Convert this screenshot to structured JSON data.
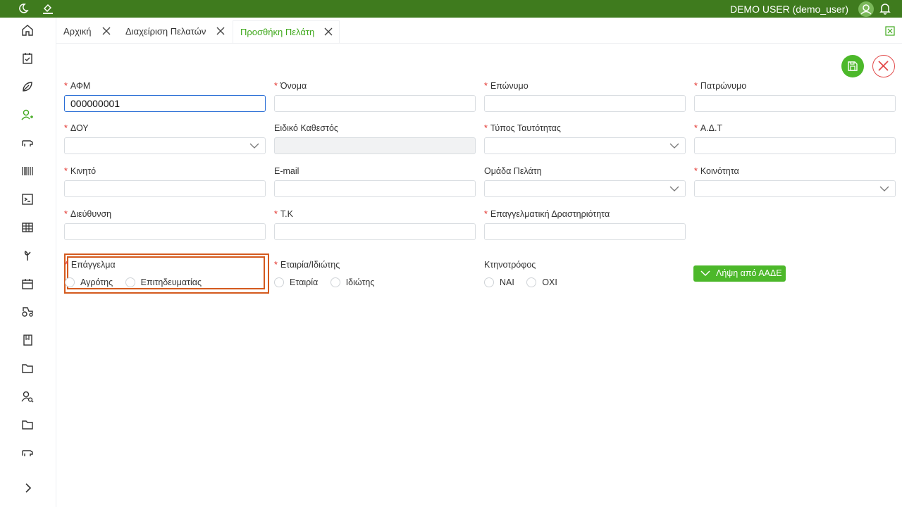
{
  "topbar": {
    "user_label": "DEMO USER (demo_user)",
    "colors": {
      "background": "#3f7b1e"
    }
  },
  "tabs": [
    {
      "label": "Αρχική",
      "active": false
    },
    {
      "label": "Διαχείριση Πελατών",
      "active": false
    },
    {
      "label": "Προσθήκη Πελάτη",
      "active": true
    }
  ],
  "form": {
    "afm": {
      "label": "ΑΦΜ",
      "value": "000000001",
      "required": true
    },
    "onoma": {
      "label": "Όνομα",
      "value": "",
      "required": true
    },
    "eponymo": {
      "label": "Επώνυμο",
      "value": "",
      "required": true
    },
    "patronymo": {
      "label": "Πατρώνυμο",
      "value": "",
      "required": true
    },
    "doy": {
      "label": "ΔΟΥ",
      "value": "",
      "required": true
    },
    "eidiko": {
      "label": "Ειδικό Καθεστός",
      "value": "",
      "required": false
    },
    "typos": {
      "label": "Τύπος Ταυτότητας",
      "value": "",
      "required": true
    },
    "adt": {
      "label": "Α.Δ.Τ",
      "value": "",
      "required": true
    },
    "kinito": {
      "label": "Κινητό",
      "value": "",
      "required": true
    },
    "email": {
      "label": "E-mail",
      "value": "",
      "required": false
    },
    "omada": {
      "label": "Ομάδα Πελάτη",
      "value": "",
      "required": false
    },
    "koinotita": {
      "label": "Κοινότητα",
      "value": "",
      "required": true
    },
    "dieuthinsi": {
      "label": "Διεύθυνση",
      "value": "",
      "required": true
    },
    "tk": {
      "label": "Τ.Κ",
      "value": "",
      "required": true
    },
    "drastiriotita": {
      "label": "Επαγγελματική Δραστηριότητα",
      "value": "",
      "required": true
    },
    "epaggelma": {
      "label": "Επάγγελμα",
      "options": [
        "Αγρότης",
        "Επιτηδευματίας"
      ],
      "required": true
    },
    "etairia": {
      "label": "Εταιρία/Ιδιώτης",
      "options": [
        "Εταιρία",
        "Ιδιώτης"
      ],
      "required": true
    },
    "ktinotrofos": {
      "label": "Κτηνοτρόφος",
      "options": [
        "ΝΑΙ",
        "ΟΧΙ"
      ],
      "required": false
    },
    "aade_button": "Λήψη από ΑΑΔΕ"
  },
  "colors": {
    "accent": "#4cb82a",
    "required": "#e2312b",
    "highlight": "#d45a1e"
  }
}
